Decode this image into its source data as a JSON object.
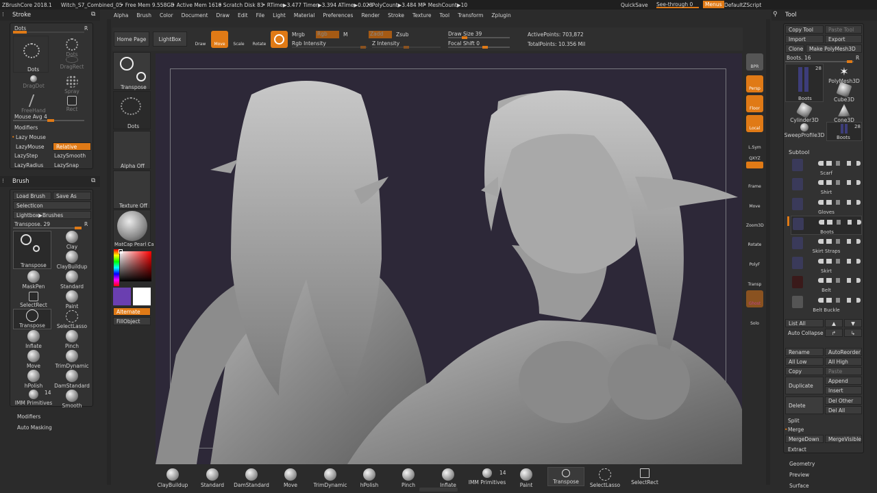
{
  "topbar": {
    "title": "ZBrushCore 2018.1",
    "file": "Witch_S7_Combined_05",
    "free_mem": "• Free Mem 9.558GB",
    "active_mem": "• Active Mem 1610",
    "scratch": "• Scratch Disk 83",
    "rtime": "• RTime▶3.477 Timer▶3.394 ATime▶0.028",
    "polycount": "• PolyCount▶3.484 MP",
    "meshcount": "• MeshCount▶10",
    "quicksave": "QuickSave",
    "seethrough": "See-through  0",
    "menus": "Menus",
    "script": "DefaultZScript"
  },
  "menubar": [
    "Alpha",
    "Brush",
    "Color",
    "Document",
    "Draw",
    "Edit",
    "File",
    "Light",
    "Material",
    "Preferences",
    "Render",
    "Stroke",
    "Texture",
    "Tool",
    "Transform",
    "Zplugin"
  ],
  "stroke": {
    "title": "Stroke",
    "dots_slider": "Dots",
    "items": [
      "Dots",
      "Dots",
      "DragRect",
      "DragDot",
      "Spray",
      "FreeHand",
      "Rect"
    ],
    "mouse_avg": "Mouse Avg 4",
    "modifiers": "Modifiers",
    "lazy_mouse": "Lazy Mouse",
    "lazymouse_btn": "LazyMouse",
    "relative": "Relative",
    "lazystep": "LazyStep",
    "lazysmooth": "LazySmooth",
    "lazyradius": "LazyRadius",
    "lazysnap": "LazySnap"
  },
  "brush": {
    "title": "Brush",
    "load": "Load Brush",
    "save": "Save As",
    "selecticon": "SelectIcon",
    "lightbox": "Lightbox▶Brushes",
    "transpose_slider": "Transpose. 29",
    "r": "R",
    "tiles": [
      "Transpose",
      "Clay",
      "ClayBuildup",
      "MaskPen",
      "Standard",
      "SelectRect",
      "Paint",
      "Transpose",
      "SelectLasso",
      "Inflate",
      "Pinch",
      "Move",
      "TrimDynamic",
      "hPolish",
      "DamStandard",
      "IMM Primitives",
      "Smooth"
    ],
    "imm_count": "14",
    "modifiers": "Modifiers",
    "auto_masking": "Auto Masking"
  },
  "toolbar": {
    "home": "Home Page",
    "lightbox": "LightBox",
    "draw": "Draw",
    "move": "Move",
    "scale": "Scale",
    "rotate": "Rotate",
    "mrgb": "Mrgb",
    "rgb": "Rgb",
    "m": "M",
    "zadd": "Zadd",
    "zsub": "Zsub",
    "rgb_intensity": "Rgb Intensity",
    "z_intensity": "Z Intensity",
    "draw_size": "Draw Size 39",
    "focal_shift": "Focal Shift 0",
    "active_points": "ActivePoints: 703,872",
    "total_points": "TotalPoints: 10.356 Mil"
  },
  "leftshelf": {
    "transpose": "Transpose",
    "dots": "Dots",
    "alpha_off": "Alpha Off",
    "texture_off": "Texture Off",
    "matcap": "MatCap Pearl Ca",
    "alternate": "Alternate",
    "fillobject": "FillObject"
  },
  "rightshelf": [
    "BPR",
    "Persp",
    "Floor",
    "Local",
    "L.Sym",
    "QXYZ",
    "Frame",
    "Move",
    "Zoom3D",
    "Rotate",
    "PolyF",
    "Transp",
    "Ghost",
    "Solo"
  ],
  "tool": {
    "title": "Tool",
    "copy_tool": "Copy Tool",
    "paste_tool": "Paste Tool",
    "import": "Import",
    "export": "Export",
    "clone": "Clone",
    "make_polymesh": "Make PolyMesh3D",
    "boots_slider": "Boots. 16",
    "r": "R",
    "thumbs": [
      {
        "name": "Boots",
        "count": "28"
      },
      {
        "name": "PolyMesh3D"
      },
      {
        "name": "Cube3D"
      },
      {
        "name": "Cylinder3D"
      },
      {
        "name": "Cone3D"
      },
      {
        "name": "SweepProfile3D"
      },
      {
        "name": "Boots",
        "count": "28"
      }
    ],
    "subtool_title": "Subtool",
    "subtools": [
      "Scarf",
      "Shirt",
      "Gloves",
      "Boots",
      "Skirt Straps",
      "Skirt",
      "Belt",
      "Belt Buckle"
    ],
    "list_all": "List All",
    "auto_collapse": "Auto Collapse",
    "rename": "Rename",
    "autoreorder": "AutoReorder",
    "all_low": "All Low",
    "all_high": "All High",
    "copy": "Copy",
    "paste": "Paste",
    "duplicate": "Duplicate",
    "append": "Append",
    "insert": "Insert",
    "delete": "Delete",
    "del_other": "Del Other",
    "del_all": "Del All",
    "split": "Split",
    "merge": "Merge",
    "mergedown": "MergeDown",
    "mergevisible": "MergeVisible",
    "extract": "Extract",
    "geometry": "Geometry",
    "preview": "Preview",
    "surface": "Surface"
  },
  "bottom": [
    "ClayBuildup",
    "Standard",
    "DamStandard",
    "Move",
    "TrimDynamic",
    "hPolish",
    "Pinch",
    "Inflate",
    "IMM Primitives",
    "Paint",
    "Transpose",
    "SelectLasso",
    "SelectRect"
  ],
  "bottom_imm_count": "14",
  "colors": {
    "accent": "#e07a16",
    "canvas": "#2d2838"
  }
}
